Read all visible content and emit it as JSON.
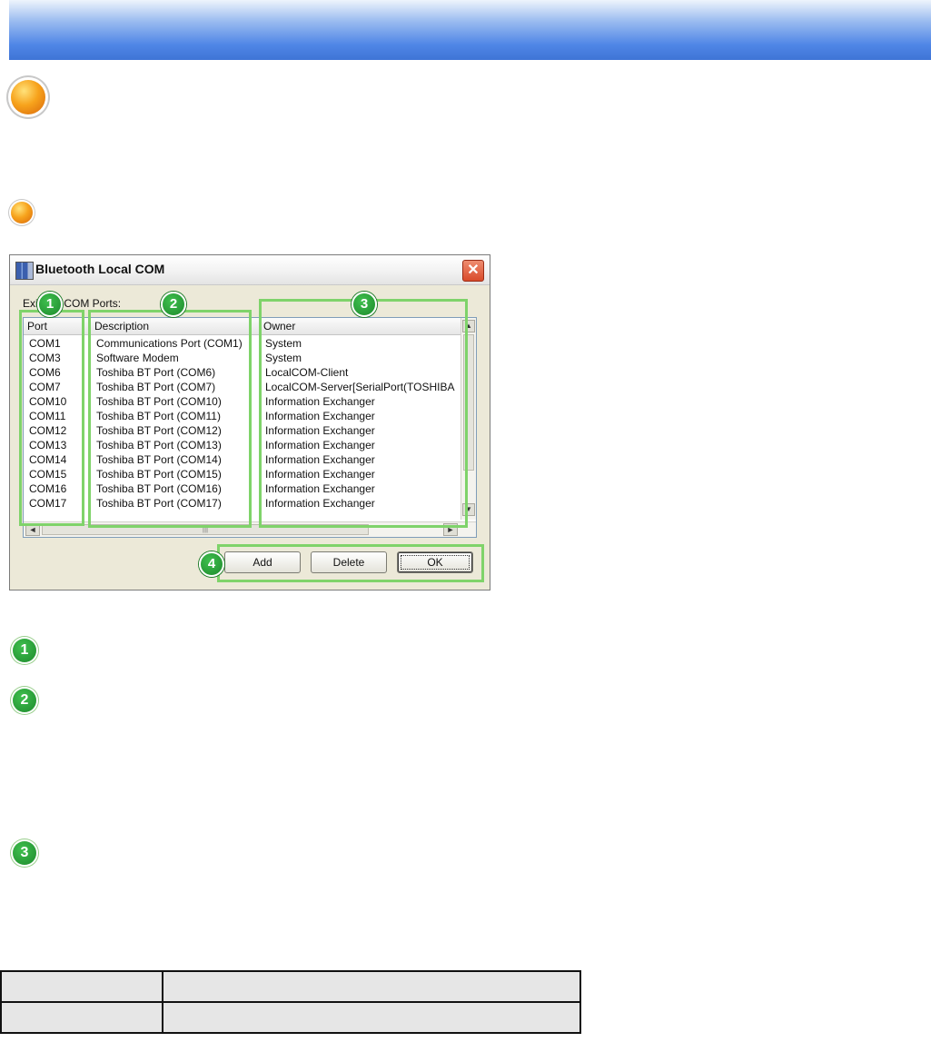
{
  "dialog": {
    "title": "Bluetooth Local COM",
    "close_glyph": "✕",
    "existing_label": "Existing COM Ports:",
    "columns": [
      "Port",
      "Description",
      "Owner"
    ],
    "rows": [
      {
        "port": "COM1",
        "description": "Communications Port (COM1)",
        "owner": "System"
      },
      {
        "port": "COM3",
        "description": "Software Modem",
        "owner": "System"
      },
      {
        "port": "COM6",
        "description": "Toshiba BT Port (COM6)",
        "owner": "LocalCOM-Client"
      },
      {
        "port": "COM7",
        "description": "Toshiba BT Port (COM7)",
        "owner": "LocalCOM-Server[SerialPort(TOSHIBA"
      },
      {
        "port": "COM10",
        "description": "Toshiba BT Port (COM10)",
        "owner": "Information Exchanger"
      },
      {
        "port": "COM11",
        "description": "Toshiba BT Port (COM11)",
        "owner": "Information Exchanger"
      },
      {
        "port": "COM12",
        "description": "Toshiba BT Port (COM12)",
        "owner": "Information Exchanger"
      },
      {
        "port": "COM13",
        "description": "Toshiba BT Port (COM13)",
        "owner": "Information Exchanger"
      },
      {
        "port": "COM14",
        "description": "Toshiba BT Port (COM14)",
        "owner": "Information Exchanger"
      },
      {
        "port": "COM15",
        "description": "Toshiba BT Port (COM15)",
        "owner": "Information Exchanger"
      },
      {
        "port": "COM16",
        "description": "Toshiba BT Port (COM16)",
        "owner": "Information Exchanger"
      },
      {
        "port": "COM17",
        "description": "Toshiba BT Port (COM17)",
        "owner": "Information Exchanger"
      }
    ],
    "buttons": {
      "add": "Add",
      "delete": "Delete",
      "ok": "OK"
    },
    "scroll_glyphs": {
      "up": "▲",
      "down": "▼",
      "left": "◄",
      "right": "►",
      "grip": "|||"
    }
  },
  "callouts": [
    "1",
    "2",
    "3",
    "4"
  ],
  "section_markers": [
    "1",
    "2",
    "3"
  ],
  "colors": {
    "highlight": "#7fd36a",
    "callout_green": "#1d8a2c",
    "bullet_orange": "#f7a31c",
    "banner_blue": "#4f86e6"
  }
}
